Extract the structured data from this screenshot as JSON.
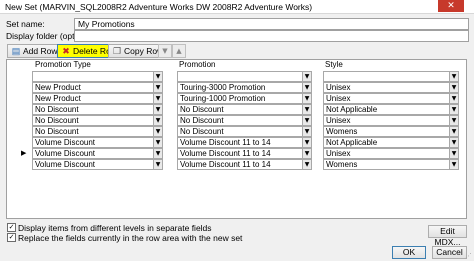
{
  "window": {
    "title": "New Set (MARVIN_SQL2008R2 Adventure Works DW 2008R2 Adventure Works)",
    "close_glyph": "✕"
  },
  "form": {
    "set_name_label": "Set name:",
    "set_name_value": "My Promotions",
    "display_folder_label": "Display folder (optional):",
    "display_folder_value": ""
  },
  "toolbar": {
    "add_row_label": "Add Row",
    "delete_row_label": "Delete Row",
    "copy_row_label": "Copy Row",
    "move_down_glyph": "▼",
    "move_up_glyph": "▲"
  },
  "grid": {
    "columns": [
      "Promotion Type",
      "Promotion",
      "Style"
    ],
    "dropdown_glyph": "▼",
    "current_row_marker": "▶",
    "current_row_index": 7,
    "rows": [
      [
        "",
        "",
        ""
      ],
      [
        "New Product",
        "Touring-3000 Promotion",
        "Unisex"
      ],
      [
        "New Product",
        "Touring-1000 Promotion",
        "Unisex"
      ],
      [
        "No Discount",
        "No Discount",
        "Not Applicable"
      ],
      [
        "No Discount",
        "No Discount",
        "Unisex"
      ],
      [
        "No Discount",
        "No Discount",
        "Womens"
      ],
      [
        "Volume Discount",
        "Volume Discount 11 to 14",
        "Not Applicable"
      ],
      [
        "Volume Discount",
        "Volume Discount 11 to 14",
        "Unisex"
      ],
      [
        "Volume Discount",
        "Volume Discount 11 to 14",
        "Womens"
      ]
    ]
  },
  "options": {
    "separate_fields_label": "Display items from different levels in separate fields",
    "separate_fields_checked": true,
    "replace_fields_label": "Replace the fields currently in the row area with the new set",
    "replace_fields_checked": true,
    "check_glyph": "✓"
  },
  "buttons": {
    "edit_mdx_label": "Edit MDX...",
    "ok_label": "OK",
    "cancel_label": "Cancel"
  }
}
